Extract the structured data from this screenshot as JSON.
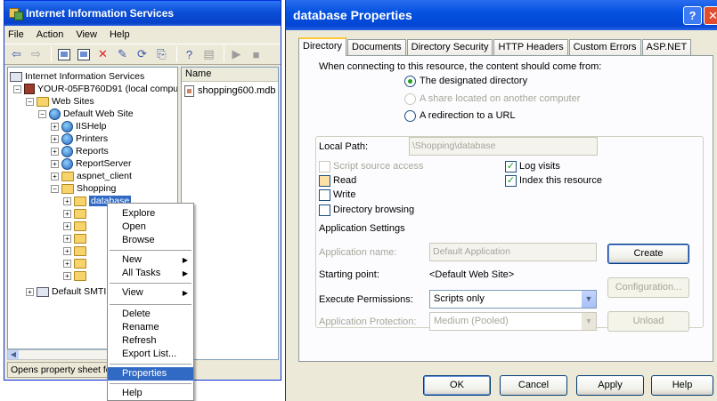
{
  "iis": {
    "title": "Internet Information Services",
    "menu": [
      "File",
      "Action",
      "View",
      "Help"
    ],
    "tree": {
      "root": "Internet Information Services",
      "computer": "YOUR-05FB760D91 (local compu",
      "web_sites": "Web Sites",
      "default_site": "Default Web Site",
      "children": [
        "IISHelp",
        "Printers",
        "Reports",
        "ReportServer",
        "aspnet_client",
        "Shopping"
      ],
      "selected": "database",
      "smtp": "Default SMTI"
    },
    "list": {
      "column": "Name",
      "items": [
        "shopping600.mdb"
      ]
    },
    "status": "Opens property sheet fo"
  },
  "context_menu": {
    "items": [
      "Explore",
      "Open",
      "Browse",
      "New",
      "All Tasks",
      "View",
      "Delete",
      "Rename",
      "Refresh",
      "Export List...",
      "Properties",
      "Help"
    ],
    "highlighted": "Properties"
  },
  "dialog": {
    "title": "database Properties",
    "tabs": [
      "Directory",
      "Documents",
      "Directory Security",
      "HTTP Headers",
      "Custom Errors",
      "ASP.NET"
    ],
    "active_tab": "Directory",
    "intro": "When connecting to this resource, the content should come from:",
    "source_options": [
      "The designated directory",
      "A share located on another computer",
      "A redirection to a URL"
    ],
    "local_path_label": "Local Path:",
    "local_path_value": "\\Shopping\\database",
    "checks": {
      "script_source_access": "Script source access",
      "read": "Read",
      "write": "Write",
      "directory_browsing": "Directory browsing",
      "log_visits": "Log visits",
      "index_resource": "Index this resource"
    },
    "app_settings_label": "Application Settings",
    "app_name_label": "Application name:",
    "app_name_value": "Default Application",
    "starting_point_label": "Starting point:",
    "starting_point_value": "<Default Web Site>",
    "exec_perm_label": "Execute Permissions:",
    "exec_perm_value": "Scripts only",
    "app_protection_label": "Application Protection:",
    "app_protection_value": "Medium (Pooled)",
    "buttons": {
      "create": "Create",
      "configuration": "Configuration...",
      "unload": "Unload",
      "ok": "OK",
      "cancel": "Cancel",
      "apply": "Apply",
      "help": "Help"
    }
  },
  "colors": {
    "title_blue": "#0a4fd6",
    "selection": "#316ac5",
    "check_green": "#21a121",
    "window_bg": "#ece9d8"
  }
}
